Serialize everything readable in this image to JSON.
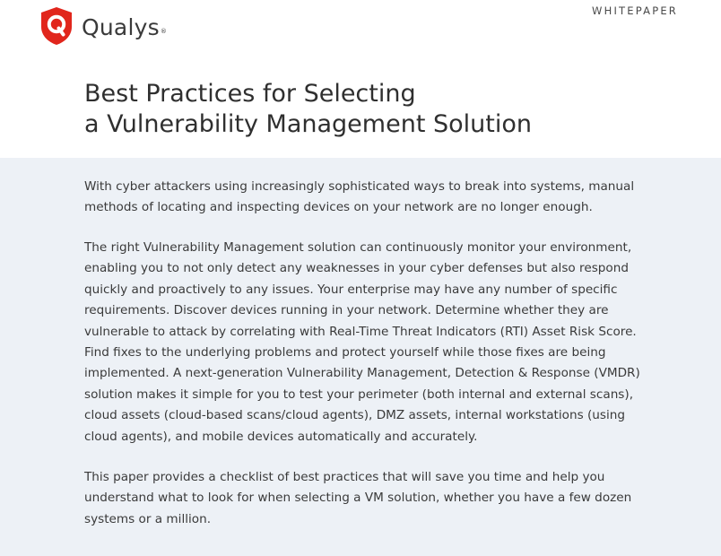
{
  "header": {
    "brand_name": "Qualys",
    "brand_mark": "®",
    "logo_icon": "shield-q-icon",
    "brand_color": "#e1261c",
    "doc_type": "WHITEPAPER"
  },
  "title": {
    "lines": [
      "Best Practices for Selecting",
      "a Vulnerability Management Solution"
    ]
  },
  "body": {
    "background": "#edf1f6",
    "paragraphs": [
      {
        "lines": [
          "With cyber attackers using increasingly sophisticated ways to break into systems, manual",
          "methods of locating and inspecting devices on your network are no longer enough."
        ]
      },
      {
        "lines": [
          "The right Vulnerability Management solution can continuously monitor your environment,",
          "enabling you to not only detect any weaknesses in your cyber defenses but also respond",
          "quickly and proactively to any issues. Your enterprise may have any number of specific",
          "requirements. Discover devices running in your network. Determine whether they are",
          "vulnerable to attack by correlating with Real-Time Threat Indicators (RTI) Asset Risk Score.",
          "Find fixes to the underlying problems and protect yourself while those fixes are being",
          "implemented. A next-generation Vulnerability Management, Detection & Response (VMDR)",
          "solution makes it simple for you to test your perimeter (both internal and external scans),",
          "cloud assets (cloud-based scans/cloud agents), DMZ assets, internal workstations (using",
          "cloud agents), and mobile devices automatically and accurately."
        ]
      },
      {
        "lines": [
          "This paper provides a checklist of best practices that will save you time and help you",
          "understand what to look for when selecting a VM solution, whether you have a few dozen",
          "systems or a million."
        ]
      }
    ]
  }
}
